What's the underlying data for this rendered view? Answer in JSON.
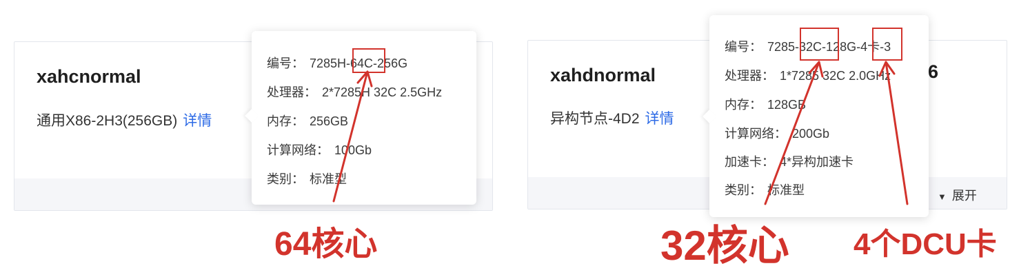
{
  "left_card": {
    "title": "xahcnormal",
    "spec": "通用X86-2H3(256GB)",
    "detail_link": "详情"
  },
  "left_popover": {
    "rows": [
      {
        "label": "编号：",
        "value": "7285H-64C-256G"
      },
      {
        "label": "处理器：",
        "value": "2*7285H 32C 2.5GHz"
      },
      {
        "label": "内存：",
        "value": "256GB"
      },
      {
        "label": "计算网络：",
        "value": "100Gb"
      },
      {
        "label": "类别：",
        "value": "标准型"
      }
    ]
  },
  "right_card": {
    "title": "xahdnormal",
    "spec": "异构节点-4D2",
    "detail_link": "详情",
    "partial_value": "6",
    "expand_icon": "▼",
    "expand_label": "展开"
  },
  "right_popover": {
    "rows": [
      {
        "label": "编号：",
        "value": "7285-32C-128G-4卡-3"
      },
      {
        "label": "处理器：",
        "value": "1*7285 32C 2.0GHz"
      },
      {
        "label": "内存：",
        "value": "128GB"
      },
      {
        "label": "计算网络：",
        "value": "200Gb"
      },
      {
        "label": "加速卡：",
        "value": "4*异构加速卡"
      },
      {
        "label": "类别：",
        "value": "标准型"
      }
    ]
  },
  "annotations": {
    "left_note": "64核心",
    "right_note_cores": "32核心",
    "right_note_cards": "4个DCU卡",
    "color": "#d2332c"
  }
}
